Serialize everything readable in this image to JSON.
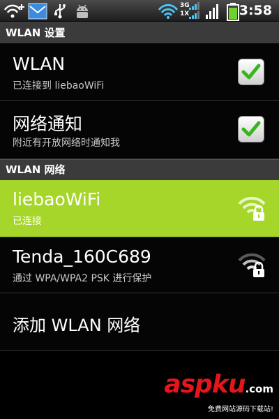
{
  "status_bar": {
    "time": "3:58",
    "signal_3g_label": "3G",
    "signal_1x_label": "1X",
    "icons": [
      "wifi-plus-icon",
      "email-icon",
      "usb-icon",
      "android-debug-icon",
      "wifi-signal-icon",
      "cell-signal-3g-icon",
      "cell-signal-1x-icon",
      "cell-signal-icon",
      "battery-icon"
    ],
    "battery_level": 0.85
  },
  "header": {
    "title": "WLAN 设置"
  },
  "settings": {
    "wlan": {
      "title": "WLAN",
      "subtitle": "已连接到 liebaoWiFi",
      "checked": true
    },
    "network_notify": {
      "title": "网络通知",
      "subtitle": "附近有开放网络时通知我",
      "checked": true
    }
  },
  "networks_section": {
    "title": "WLAN 网络"
  },
  "networks": [
    {
      "ssid": "liebaoWiFi",
      "status": "已连接",
      "icon": "wifi-locked-icon"
    },
    {
      "ssid": "Tenda_160C689",
      "status": "通过 WPA/WPA2 PSK 进行保护",
      "icon": "wifi-locked-icon"
    }
  ],
  "add_network": {
    "label": "添加 WLAN 网络"
  },
  "watermark": {
    "logo": "aspku",
    "suffix": ".com",
    "tagline": "免费网站源码下载站!"
  },
  "colors": {
    "selected_row": "#a6d62a",
    "check_green": "#39b51f",
    "watermark_red": "#e4161c"
  }
}
